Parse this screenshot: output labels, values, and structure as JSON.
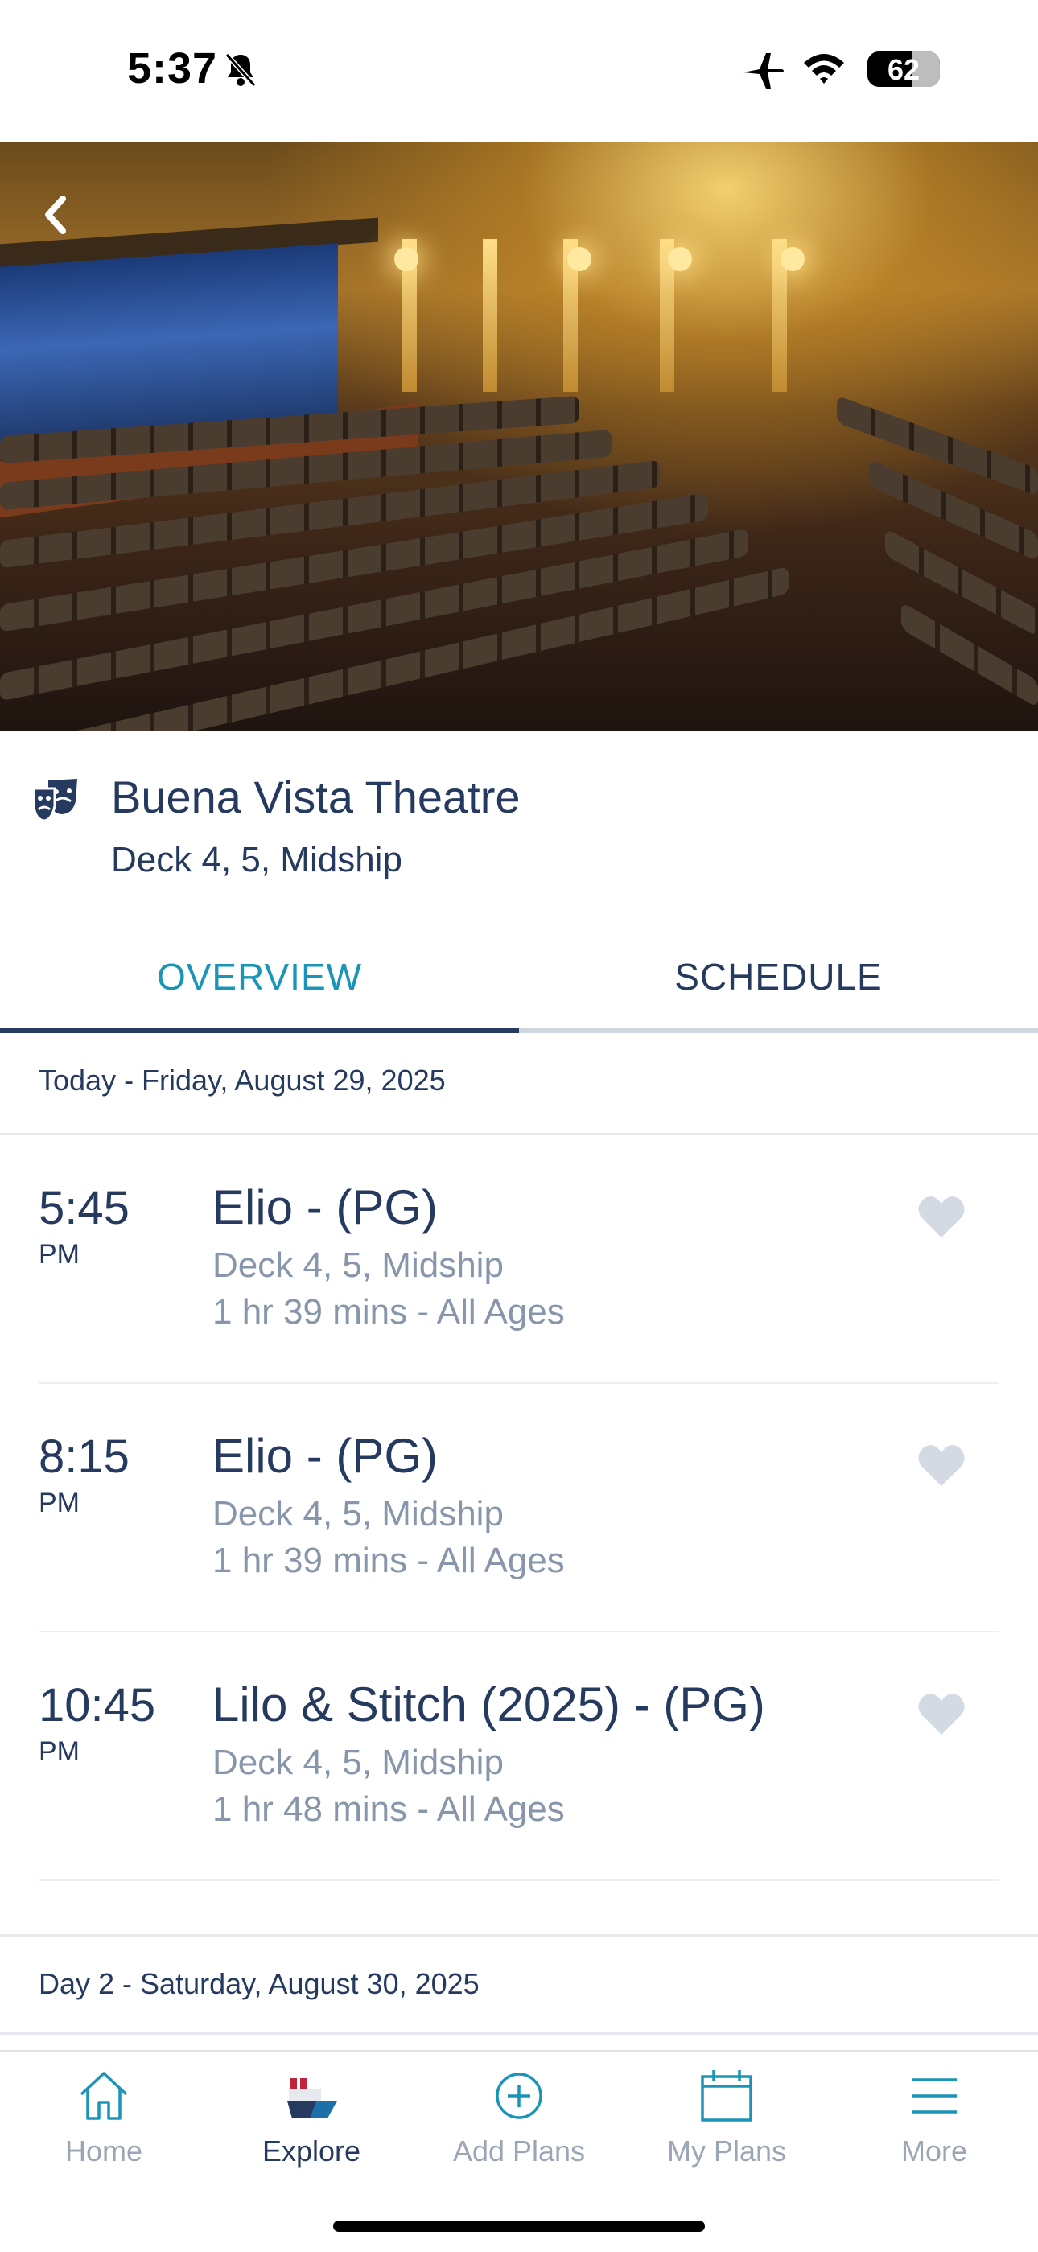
{
  "status_bar": {
    "time": "5:37",
    "battery": "62"
  },
  "venue": {
    "name": "Buena Vista Theatre",
    "location": "Deck 4, 5, Midship",
    "icon": "theatre-masks-icon"
  },
  "tabs": [
    {
      "label": "OVERVIEW",
      "active": false
    },
    {
      "label": "SCHEDULE",
      "active": true
    }
  ],
  "days": [
    {
      "header": "Today - Friday, August 29, 2025",
      "items": [
        {
          "time": "5:45",
          "ampm": "PM",
          "title": "Elio - (PG)",
          "location": "Deck 4, 5, Midship",
          "details": "1 hr 39 mins - All Ages"
        },
        {
          "time": "8:15",
          "ampm": "PM",
          "title": "Elio - (PG)",
          "location": "Deck 4, 5, Midship",
          "details": "1 hr 39 mins - All Ages"
        },
        {
          "time": "10:45",
          "ampm": "PM",
          "title": "Lilo & Stitch (2025) - (PG)",
          "location": "Deck 4, 5, Midship",
          "details": "1 hr 48 mins - All Ages"
        }
      ]
    },
    {
      "header": "Day 2 - Saturday, August 30, 2025",
      "items": []
    }
  ],
  "bottom_nav": [
    {
      "label": "Home",
      "icon": "home-icon"
    },
    {
      "label": "Explore",
      "icon": "ship-icon",
      "active": true
    },
    {
      "label": "Add Plans",
      "icon": "plus-circle-icon"
    },
    {
      "label": "My Plans",
      "icon": "calendar-icon"
    },
    {
      "label": "More",
      "icon": "menu-icon"
    }
  ],
  "colors": {
    "accent": "#1a95b7",
    "navy": "#253a5e",
    "muted": "#8796ab",
    "heart": "#d3dae3"
  }
}
